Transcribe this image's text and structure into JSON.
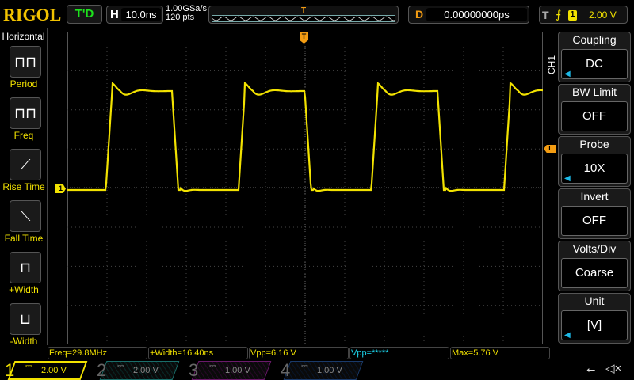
{
  "header": {
    "logo": "RIGOL",
    "status": "T'D",
    "h_label": "H",
    "timebase": "10.0ns",
    "sample_rate": "1.00GSa/s",
    "points": "120 pts",
    "d_label": "D",
    "delay": "0.00000000ps",
    "t_label": "T",
    "trigger_channel": "1",
    "trigger_level": "2.00 V"
  },
  "left_menu": {
    "title": "Horizontal",
    "items": [
      {
        "label": "Period"
      },
      {
        "label": "Freq"
      },
      {
        "label": "Rise Time"
      },
      {
        "label": "Fall Time"
      },
      {
        "label": "+Width"
      },
      {
        "label": "-Width"
      }
    ]
  },
  "right_menu": {
    "channel": "CH1",
    "items": [
      {
        "title": "Coupling",
        "value": "DC",
        "arrow": true
      },
      {
        "title": "BW Limit",
        "value": "OFF",
        "arrow": false
      },
      {
        "title": "Probe",
        "value": "10X",
        "arrow": true
      },
      {
        "title": "Invert",
        "value": "OFF",
        "arrow": false
      },
      {
        "title": "Volts/Div",
        "value": "Coarse",
        "arrow": false
      },
      {
        "title": "Unit",
        "value": "[V]",
        "arrow": true
      }
    ]
  },
  "markers": {
    "ch1": "1",
    "trigger": "T"
  },
  "measurements": [
    "Freq=29.8MHz",
    "+Width=16.40ns",
    "Vpp=6.16 V",
    "Vpp=*****",
    "Max=5.76 V"
  ],
  "channels": [
    {
      "num": "1",
      "scale": "2.00 V",
      "color": "#f2e200"
    },
    {
      "num": "2",
      "scale": "2.00 V",
      "color": "#1a6e6a"
    },
    {
      "num": "3",
      "scale": "1.00 V",
      "color": "#6a1a6a"
    },
    {
      "num": "4",
      "scale": "1.00 V",
      "color": "#1a3a6a"
    }
  ],
  "colors": {
    "trace": "#f2e200",
    "accent": "#f39c12",
    "arrow": "#1cb8e6"
  }
}
